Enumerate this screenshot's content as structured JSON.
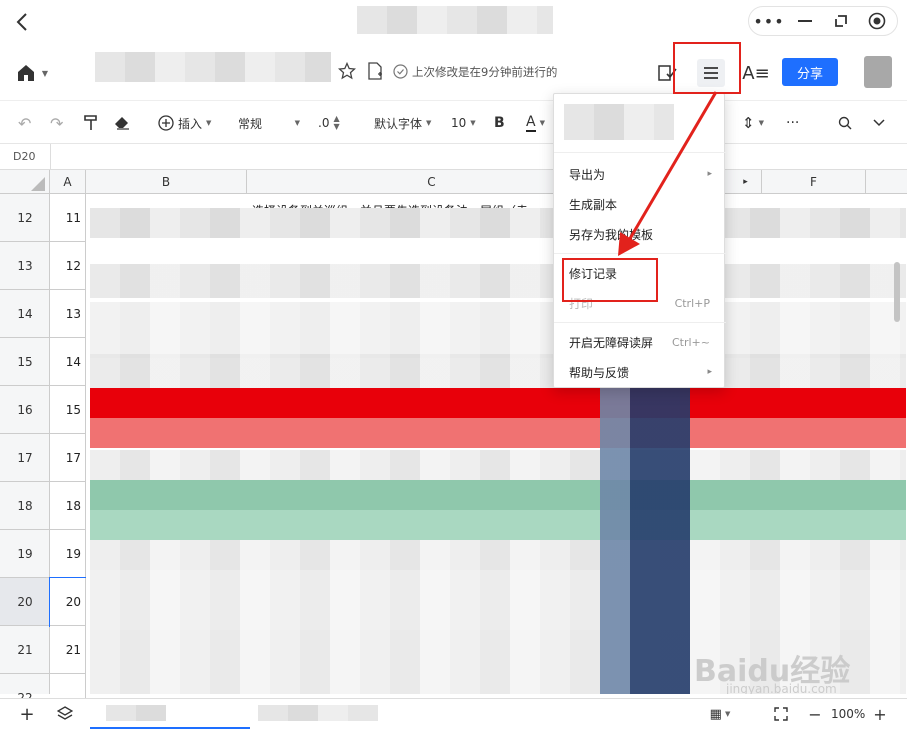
{
  "titlebar": {
    "back_icon": "chevron-left-icon",
    "more_icon": "more-dots-icon",
    "minimize_icon": "minimize-icon",
    "restore_icon": "restore-icon",
    "record_icon": "record-icon"
  },
  "toolbar1": {
    "home_icon": "home-icon",
    "status": "上次修改是在9分钟前进行的",
    "share": "分享",
    "share_color": "#1e6fff"
  },
  "toolbar2": {
    "insert": "插入",
    "format": "常规",
    "decimal": ".0",
    "font": "默认字体",
    "size": "10",
    "bold": "B",
    "color_a": "A"
  },
  "cell_ref": "D20",
  "columns": [
    "A",
    "B",
    "C",
    "F"
  ],
  "col_c_text": "选择设备到关巡组，并且要先选到设备法，尾组（走",
  "rows": [
    {
      "num": "12",
      "a": "11"
    },
    {
      "num": "13",
      "a": "12"
    },
    {
      "num": "14",
      "a": "13"
    },
    {
      "num": "15",
      "a": "14"
    },
    {
      "num": "16",
      "a": "15"
    },
    {
      "num": "17",
      "a": "17"
    },
    {
      "num": "18",
      "a": "18"
    },
    {
      "num": "19",
      "a": "19"
    },
    {
      "num": "20",
      "a": "20"
    },
    {
      "num": "21",
      "a": "21"
    },
    {
      "num": "22",
      "a": ""
    }
  ],
  "menu": {
    "items": [
      {
        "label": "导出为",
        "arrow": "▸"
      },
      {
        "label": "生成副本"
      },
      {
        "label": "另存为我的模板"
      },
      {
        "label": "修订记录"
      },
      {
        "label": "打印",
        "shortcut": "Ctrl+P"
      },
      {
        "label": "开启无障碍读屏",
        "shortcut": "Ctrl+~"
      },
      {
        "label": "帮助与反馈",
        "arrow": "▸"
      }
    ]
  },
  "bottom": {
    "zoom": "100%",
    "add": "+",
    "minus": "−"
  },
  "watermark": {
    "brand": "Baidu经验",
    "url": "jingyan.baidu.com"
  },
  "colors": {
    "red_band": "#e8000a",
    "pink_band": "#f07272",
    "green_band": "#9ad0b6",
    "highlight": "#e2221c"
  }
}
